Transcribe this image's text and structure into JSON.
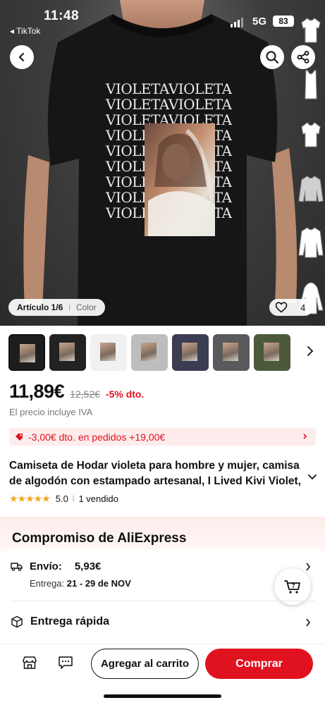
{
  "status_bar": {
    "time": "11:48",
    "back_app": "◂ TikTok",
    "network": "5G",
    "battery": "83"
  },
  "hero": {
    "print_words": [
      "VIOLETAVIOLETA",
      "VIOLETAVIOLETA",
      "VIOLETAVIOLETA",
      "VIOLETAVIOLETA",
      "VIOLETAVIOLETA",
      "VIOLETAVIOLETA",
      "VIOLETAVIOLETA",
      "VIOLETAVIOLETA",
      "VIOLETAVIOLETA",
      "VIOLETAVIOLETA"
    ],
    "article_label": "Artículo 1/6",
    "color_label": "Color",
    "favorites_count": "4"
  },
  "thumbnails": [
    {
      "name": "black",
      "color": "#1d1d1d",
      "selected": true
    },
    {
      "name": "black-2",
      "color": "#222222",
      "selected": false
    },
    {
      "name": "white",
      "color": "#f1f1f1",
      "selected": false
    },
    {
      "name": "grey",
      "color": "#bdbdbd",
      "selected": false
    },
    {
      "name": "navy",
      "color": "#3b3d52",
      "selected": false
    },
    {
      "name": "charcoal",
      "color": "#5a5a5c",
      "selected": false
    },
    {
      "name": "olive",
      "color": "#4b5a3a",
      "selected": false
    },
    {
      "name": "black-3",
      "color": "#1a1a1a",
      "selected": false
    }
  ],
  "pricing": {
    "price": "11,89€",
    "old_price": "12,52€",
    "discount": "-5% dto.",
    "vat_note": "El precio incluye IVA",
    "coupon": "-3,00€ dto. en pedidos +19,00€"
  },
  "product": {
    "title": "Camiseta de Hodar violeta para hombre y mujer, camisa de algodón con estampado artesanal, I Lived Kivi Violet,",
    "stars": "★★★★★",
    "rating": "5.0",
    "sold": "1 vendido"
  },
  "commitment": {
    "title": "Compromiso de AliExpress",
    "shipping_label": "Envío:",
    "shipping_value": "5,93€",
    "delivery_label": "Entrega:",
    "delivery_dates": "21 - 29 de NOV",
    "fast_delivery": "Entrega rápida"
  },
  "actions": {
    "add_to_cart": "Agregar al carrito",
    "buy": "Comprar"
  },
  "colors": {
    "accent": "#e1121f",
    "coupon_bg": "#fdecec",
    "star": "#f5a623"
  }
}
